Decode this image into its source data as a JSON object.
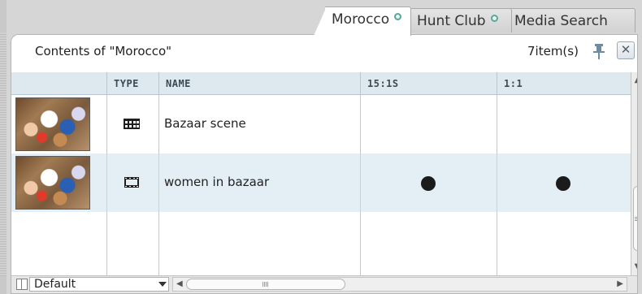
{
  "tabs": [
    {
      "label": "Morocco",
      "active": true
    },
    {
      "label": "Hunt Club",
      "active": false
    },
    {
      "label": "Media Search",
      "active": false
    }
  ],
  "header": {
    "title": "Contents of \"Morocco\"",
    "count": "7item(s)",
    "close_glyph": "✕"
  },
  "columns": [
    "",
    "TYPE",
    "NAME",
    "15:1S",
    "1:1"
  ],
  "rows": [
    {
      "name": "Bazaar scene",
      "type_icon": "sequence-icon",
      "col_15_1s": false,
      "col_1_1": false
    },
    {
      "name": "women in bazaar",
      "type_icon": "clip-icon",
      "col_15_1s": true,
      "col_1_1": true
    }
  ],
  "footer": {
    "view_select": "Default"
  }
}
